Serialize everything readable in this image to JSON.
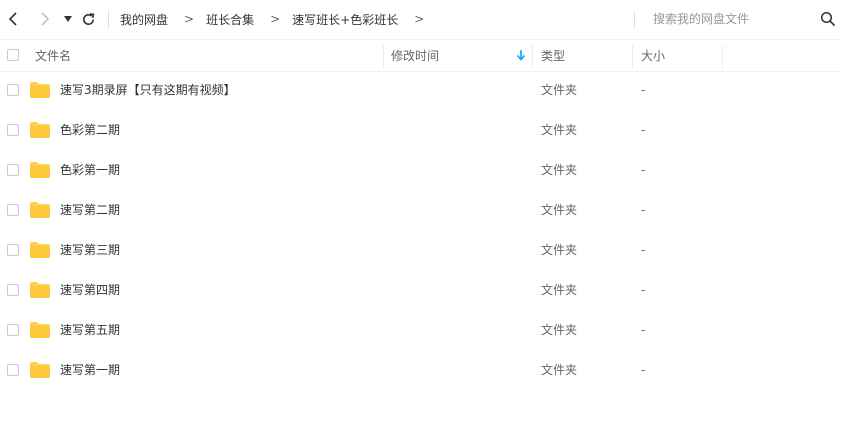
{
  "breadcrumb": [
    "我的网盘",
    "班长合集",
    "速写班长+色彩班长"
  ],
  "breadcrumb_sep": ">",
  "search": {
    "placeholder": "搜索我的网盘文件"
  },
  "columns": {
    "name": "文件名",
    "modified": "修改时间",
    "type": "类型",
    "size": "大小"
  },
  "sort_icon": "arrow-down-icon",
  "accent_color": "#06a7ff",
  "folder_color": "#ffd24d",
  "files": [
    {
      "name": "速写3期录屏【只有这期有视频】",
      "type": "文件夹",
      "size": "-"
    },
    {
      "name": "色彩第二期",
      "type": "文件夹",
      "size": "-"
    },
    {
      "name": "色彩第一期",
      "type": "文件夹",
      "size": "-"
    },
    {
      "name": "速写第二期",
      "type": "文件夹",
      "size": "-"
    },
    {
      "name": "速写第三期",
      "type": "文件夹",
      "size": "-"
    },
    {
      "name": "速写第四期",
      "type": "文件夹",
      "size": "-"
    },
    {
      "name": "速写第五期",
      "type": "文件夹",
      "size": "-"
    },
    {
      "name": "速写第一期",
      "type": "文件夹",
      "size": "-"
    }
  ]
}
